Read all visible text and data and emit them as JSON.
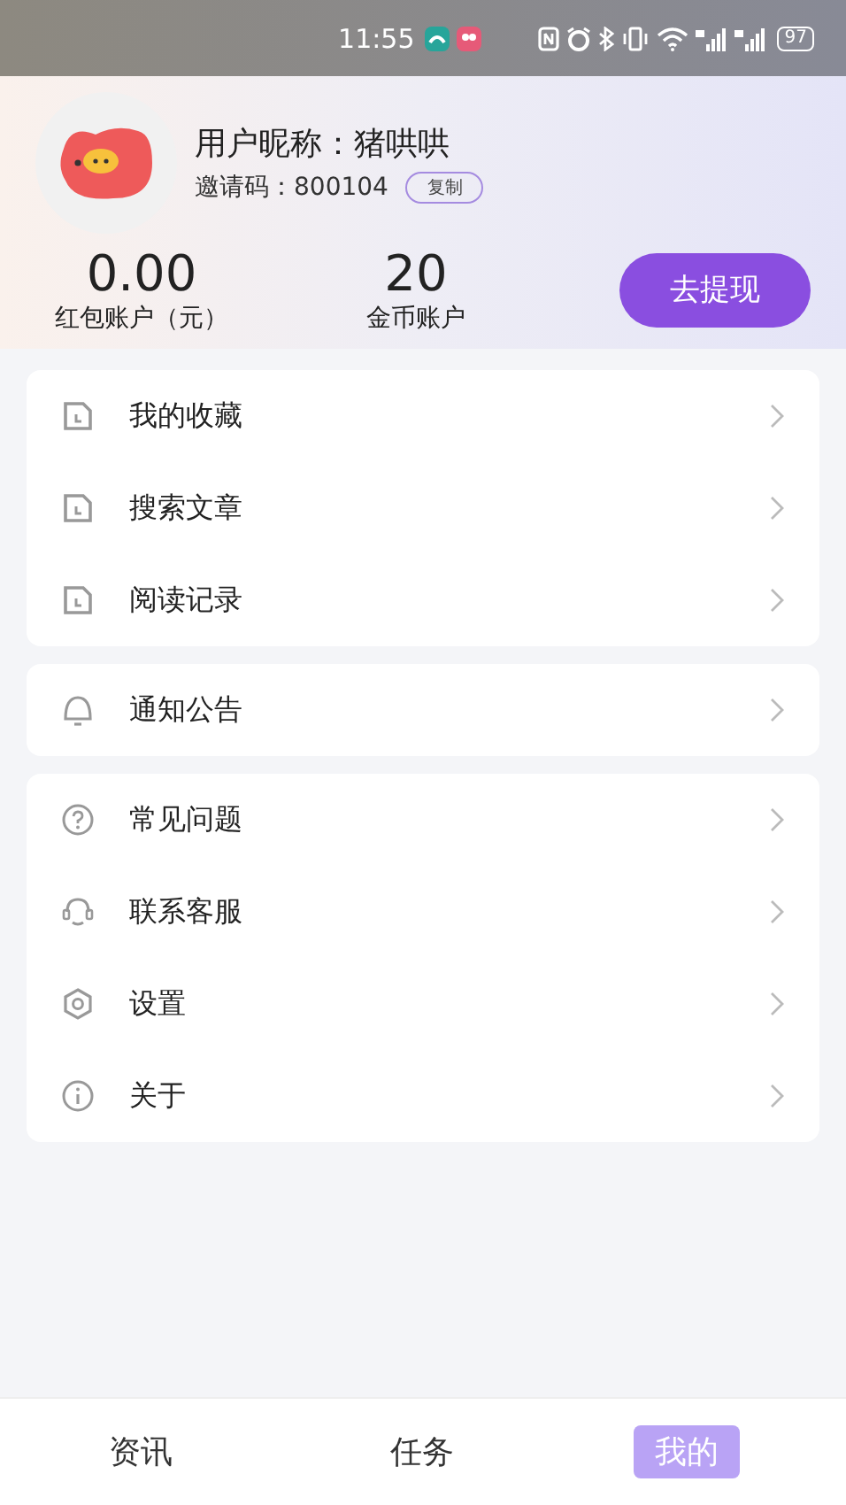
{
  "status_bar": {
    "time": "11:55",
    "battery": "97"
  },
  "profile": {
    "nickname": "用户昵称：猪哄哄",
    "invite_label": "邀请码：800104",
    "copy_button": "复制"
  },
  "accounts": [
    {
      "value": "0.00",
      "label": "红包账户（元）"
    },
    {
      "value": "20",
      "label": "金币账户"
    }
  ],
  "withdraw_button": "去提现",
  "menu_groups": [
    [
      {
        "label": "我的收藏",
        "kind": "doc"
      },
      {
        "label": "搜索文章",
        "kind": "doc"
      },
      {
        "label": "阅读记录",
        "kind": "doc"
      }
    ],
    [
      {
        "label": "通知公告",
        "kind": "bell"
      }
    ],
    [
      {
        "label": "常见问题",
        "kind": "question"
      },
      {
        "label": "联系客服",
        "kind": "headset"
      },
      {
        "label": "设置",
        "kind": "hex"
      },
      {
        "label": "关于",
        "kind": "info"
      }
    ]
  ],
  "tabs": [
    {
      "label": "资讯",
      "selected": false
    },
    {
      "label": "任务",
      "selected": false
    },
    {
      "label": "我的",
      "selected": true
    }
  ]
}
